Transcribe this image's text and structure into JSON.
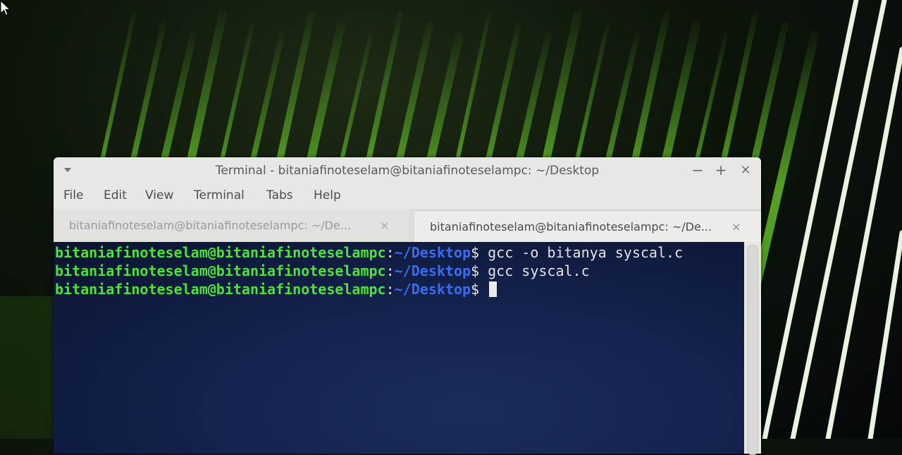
{
  "window": {
    "title": "Terminal - bitaniafinoteselam@bitaniafinoteselampc: ~/Desktop",
    "controls": {
      "minimize": "−",
      "maximize": "+",
      "close": "×"
    }
  },
  "menubar": {
    "items": [
      "File",
      "Edit",
      "View",
      "Terminal",
      "Tabs",
      "Help"
    ]
  },
  "tabs": [
    {
      "label": "bitaniafinoteselam@bitaniafinoteselampc: ~/De...",
      "close": "×",
      "active": false
    },
    {
      "label": "bitaniafinoteselam@bitaniafinoteselampc: ~/De...",
      "close": "×",
      "active": true
    }
  ],
  "terminal": {
    "lines": [
      {
        "user": "bitaniafinoteselam@bitaniafinoteselampc",
        "sep": ":",
        "path": "~/Desktop",
        "prompt": "$",
        "command": " gcc -o bitanya syscal.c"
      },
      {
        "user": "bitaniafinoteselam@bitaniafinoteselampc",
        "sep": ":",
        "path": "~/Desktop",
        "prompt": "$",
        "command": " gcc syscal.c"
      },
      {
        "user": "bitaniafinoteselam@bitaniafinoteselampc",
        "sep": ":",
        "path": "~/Desktop",
        "prompt": "$",
        "command": " "
      }
    ],
    "colors": {
      "user": "#4fe33a",
      "path": "#3b6df0",
      "text": "#e4e4e4",
      "background": "#152350"
    }
  },
  "icons": [
    "window-menu-icon",
    "mouse-pointer-icon",
    "minimize-icon",
    "maximize-icon",
    "close-icon",
    "tab-close-icon"
  ]
}
